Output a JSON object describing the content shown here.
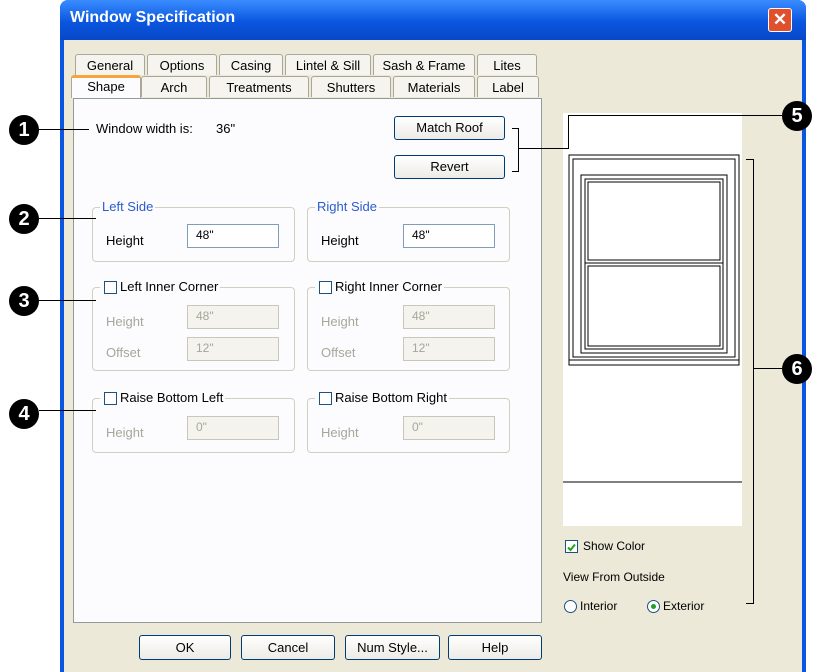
{
  "dialog": {
    "title": "Window Specification",
    "close_glyph": "✕"
  },
  "tabs": {
    "row1": [
      "General",
      "Options",
      "Casing",
      "Lintel & Sill",
      "Sash & Frame",
      "Lites"
    ],
    "row2": [
      "Shape",
      "Arch",
      "Treatments",
      "Shutters",
      "Materials",
      "Label"
    ],
    "active": "Shape"
  },
  "shape": {
    "width_label": "Window width is:",
    "width_value": "36\"",
    "match_roof": "Match Roof",
    "revert": "Revert",
    "left_side": {
      "legend": "Left Side",
      "height_label": "Height",
      "height_value": "48\""
    },
    "right_side": {
      "legend": "Right Side",
      "height_label": "Height",
      "height_value": "48\""
    },
    "left_inner": {
      "legend": "Left Inner Corner",
      "checked": false,
      "height_label": "Height",
      "height_value": "48\"",
      "offset_label": "Offset",
      "offset_value": "12\""
    },
    "right_inner": {
      "legend": "Right Inner Corner",
      "checked": false,
      "height_label": "Height",
      "height_value": "48\"",
      "offset_label": "Offset",
      "offset_value": "12\""
    },
    "raise_left": {
      "legend": "Raise Bottom Left",
      "checked": false,
      "height_label": "Height",
      "height_value": "0\""
    },
    "raise_right": {
      "legend": "Raise Bottom Right",
      "checked": false,
      "height_label": "Height",
      "height_value": "0\""
    }
  },
  "preview": {
    "show_color": "Show Color",
    "show_color_checked": true,
    "view_label": "View From Outside",
    "interior": "Interior",
    "exterior": "Exterior",
    "selected_view": "Exterior"
  },
  "buttons": {
    "ok": "OK",
    "cancel": "Cancel",
    "num_style": "Num Style...",
    "help": "Help"
  },
  "callouts": [
    "1",
    "2",
    "3",
    "4",
    "5",
    "6"
  ],
  "colors": {
    "titlebar": "#0a56e0",
    "dialog_bg": "#ece9d8",
    "active_tab_accent": "#f7a53a",
    "legend_blue": "#2a5bd0",
    "close_button": "#e0502c"
  }
}
